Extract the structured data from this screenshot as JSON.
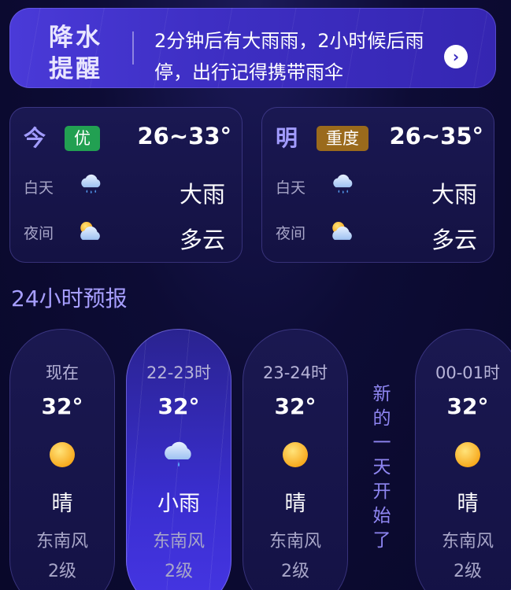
{
  "alert": {
    "title": "降水提醒",
    "message": "2分钟后有大雨雨，2小时候后雨停，出行记得携带雨伞",
    "arrow_icon": "chevron-right-icon"
  },
  "today": {
    "label": "今",
    "aqi": "优",
    "aqi_color": "#22a052",
    "temp_range": "26~33°",
    "day_label": "白天",
    "day_icon": "heavy-rain-icon",
    "day_condition": "大雨",
    "night_label": "夜间",
    "night_icon": "partly-cloudy-icon",
    "night_condition": "多云"
  },
  "tomorrow": {
    "label": "明",
    "aqi": "重度",
    "aqi_color": "#9a6a1c",
    "temp_range": "26~35°",
    "day_label": "白天",
    "day_icon": "heavy-rain-icon",
    "day_condition": "大雨",
    "night_label": "夜间",
    "night_icon": "partly-cloudy-icon",
    "night_condition": "多云"
  },
  "hourly": {
    "title": "24小时预报",
    "new_day_text": "新的一天开始了",
    "items": [
      {
        "time": "现在",
        "temp": "32°",
        "icon": "sun-icon",
        "condition": "晴",
        "wind": "东南风",
        "level": "2级"
      },
      {
        "time": "22-23时",
        "temp": "32°",
        "icon": "light-rain-icon",
        "condition": "小雨",
        "wind": "东南风",
        "level": "2级"
      },
      {
        "time": "23-24时",
        "temp": "32°",
        "icon": "sun-icon",
        "condition": "晴",
        "wind": "东南风",
        "level": "2级"
      },
      {
        "time": "00-01时",
        "temp": "32°",
        "icon": "sun-icon",
        "condition": "晴",
        "wind": "东南风",
        "level": "2级"
      }
    ]
  }
}
